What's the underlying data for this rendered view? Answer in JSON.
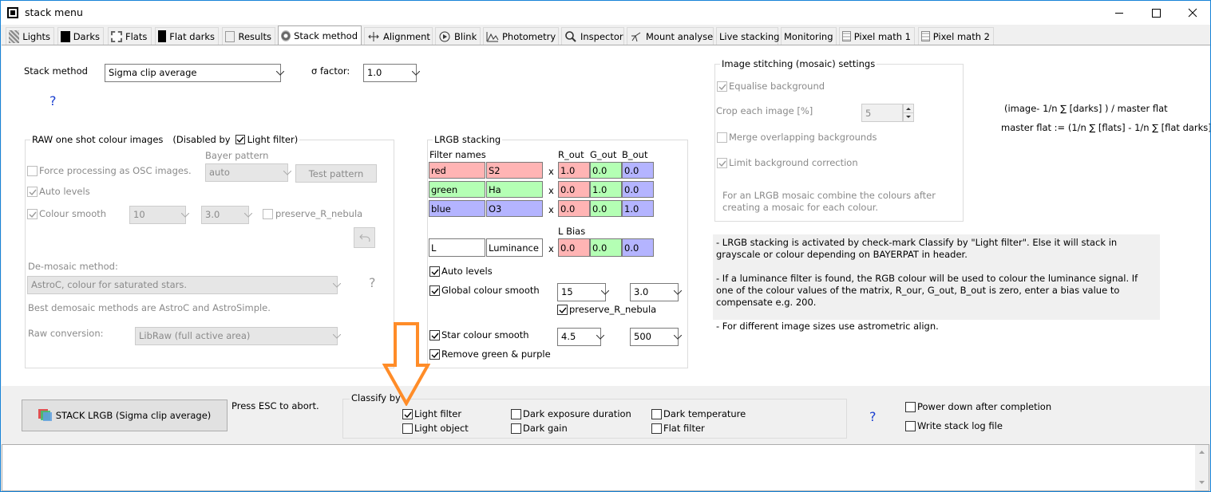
{
  "window": {
    "title": "stack menu"
  },
  "tabs": [
    {
      "label": "Lights",
      "icon": "lights-icon"
    },
    {
      "label": "Darks",
      "icon": "darks-icon"
    },
    {
      "label": "Flats",
      "icon": "flats-icon"
    },
    {
      "label": "Flat darks",
      "icon": "flat-darks-icon"
    },
    {
      "label": "Results",
      "icon": "results-icon"
    },
    {
      "label": "Stack method",
      "icon": "stack-method-icon",
      "active": true
    },
    {
      "label": "Alignment",
      "icon": "alignment-icon"
    },
    {
      "label": "Blink",
      "icon": "blink-icon"
    },
    {
      "label": "Photometry",
      "icon": "photometry-icon"
    },
    {
      "label": "Inspector",
      "icon": "inspector-icon"
    },
    {
      "label": "Mount analyse",
      "icon": "mount-analyse-icon"
    },
    {
      "label": "Live stacking"
    },
    {
      "label": "Monitoring"
    },
    {
      "label": "Pixel math 1",
      "icon": "pixel-math-icon"
    },
    {
      "label": "Pixel math 2",
      "icon": "pixel-math-icon"
    }
  ],
  "stack": {
    "method_label": "Stack method",
    "method_value": "Sigma clip average",
    "sigma_label": "σ factor:",
    "sigma_value": "1.0",
    "help": "?"
  },
  "raw": {
    "group_title": "RAW one shot colour images",
    "disabled_by": "(Disabled by",
    "light_filter": "Light filter)",
    "bayer_label": "Bayer pattern",
    "force_osc": "Force processing as OSC images.",
    "bayer_value": "auto",
    "test_pattern": "Test pattern",
    "auto_levels": "Auto levels",
    "colour_smooth": "Colour smooth",
    "smooth_value": "10",
    "smooth_value2": "3.0",
    "preserve": "preserve_R_nebula",
    "demosaic_label": "De-mosaic method:",
    "demosaic_value": "AstroC, colour for saturated stars.",
    "demosaic_hint": "Best demosaic methods are AstroC and AstroSimple.",
    "raw_conv_label": "Raw conversion:",
    "raw_conv_value": "LibRaw (full active area)",
    "help": "?"
  },
  "lrgb": {
    "group_title": "LRGB stacking",
    "filter_names": "Filter names",
    "r_out": "R_out",
    "g_out": "G_out",
    "b_out": "B_out",
    "x": "x",
    "rows": [
      {
        "name": "red",
        "filter": "S2",
        "r": "1.0",
        "g": "0.0",
        "b": "0.0"
      },
      {
        "name": "green",
        "filter": "Ha",
        "r": "0.0",
        "g": "1.0",
        "b": "0.0"
      },
      {
        "name": "blue",
        "filter": "O3",
        "r": "0.0",
        "g": "0.0",
        "b": "1.0"
      }
    ],
    "l_bias": "L Bias",
    "lum": {
      "name": "L",
      "filter": "Luminance",
      "r": "0.0",
      "g": "0.0",
      "b": "0.0"
    },
    "auto_levels": "Auto levels",
    "global_smooth": "Global colour smooth",
    "gs_value": "15",
    "gs_value2": "3.0",
    "preserve": "preserve_R_nebula",
    "star_smooth": "Star colour smooth",
    "ss_value": "4.5",
    "ss_value2": "500",
    "remove_gp": "Remove green & purple",
    "colors": {
      "red": "#ffb4b4",
      "green": "#b4ffb4",
      "blue": "#b4b4ff"
    }
  },
  "mosaic": {
    "group_title": "Image stitching (mosaic) settings",
    "equalise": "Equalise background",
    "crop_label": "Crop each image [%]",
    "crop_value": "5",
    "merge": "Merge overlapping backgrounds",
    "limit": "Limit background correction",
    "note": "For an LRGB mosaic combine the colours after creating a mosaic for each colour."
  },
  "formula": {
    "line1": "(image- 1/n ∑ [darks] ) / master flat",
    "line2": "master flat :=  (1/n ∑ [flats] - 1/n ∑ [flat darks] )"
  },
  "info": {
    "p1": "- LRGB stacking is activated by check-mark Classify by \"Light filter\". Else it will stack in grayscale or colour depending on BAYERPAT in header.",
    "p2": "- If a luminance filter is found, the RGB colour will be used to colour the luminance signal. If one of the colour values of the matrix, R_our, G_out, B_out is zero, enter a bias value to compensate e.g. 200.",
    "p3": "- For different image sizes use astrometric align."
  },
  "bottom": {
    "stack_button": "STACK LRGB (Sigma clip average)",
    "esc_hint": "Press ESC to abort.",
    "classify_title": "Classify by",
    "light_filter": "Light filter",
    "light_object": "Light object",
    "dark_exposure": "Dark exposure duration",
    "dark_gain": "Dark gain",
    "dark_temperature": "Dark temperature",
    "flat_filter": "Flat filter",
    "help": "?",
    "power_down": "Power down after completion",
    "write_log": "Write stack log file"
  },
  "accent": {
    "arrow": "#ff8c28",
    "help": "#1a3fd0"
  }
}
